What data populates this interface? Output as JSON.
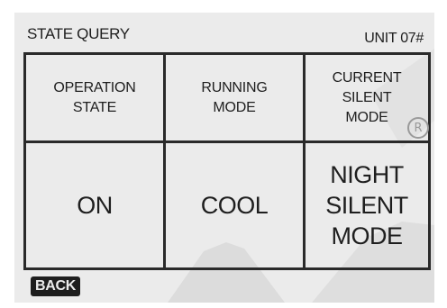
{
  "header": {
    "title": "STATE QUERY",
    "unit": "UNIT 07#"
  },
  "table": {
    "headers": [
      "OPERATION\nSTATE",
      "RUNNING\nMODE",
      "CURRENT\nSILENT\nMODE"
    ],
    "values": [
      "ON",
      "COOL",
      "NIGHT\nSILENT\nMODE"
    ]
  },
  "icons": {
    "registered_mark": "R"
  },
  "footer": {
    "back_label": "BACK"
  }
}
